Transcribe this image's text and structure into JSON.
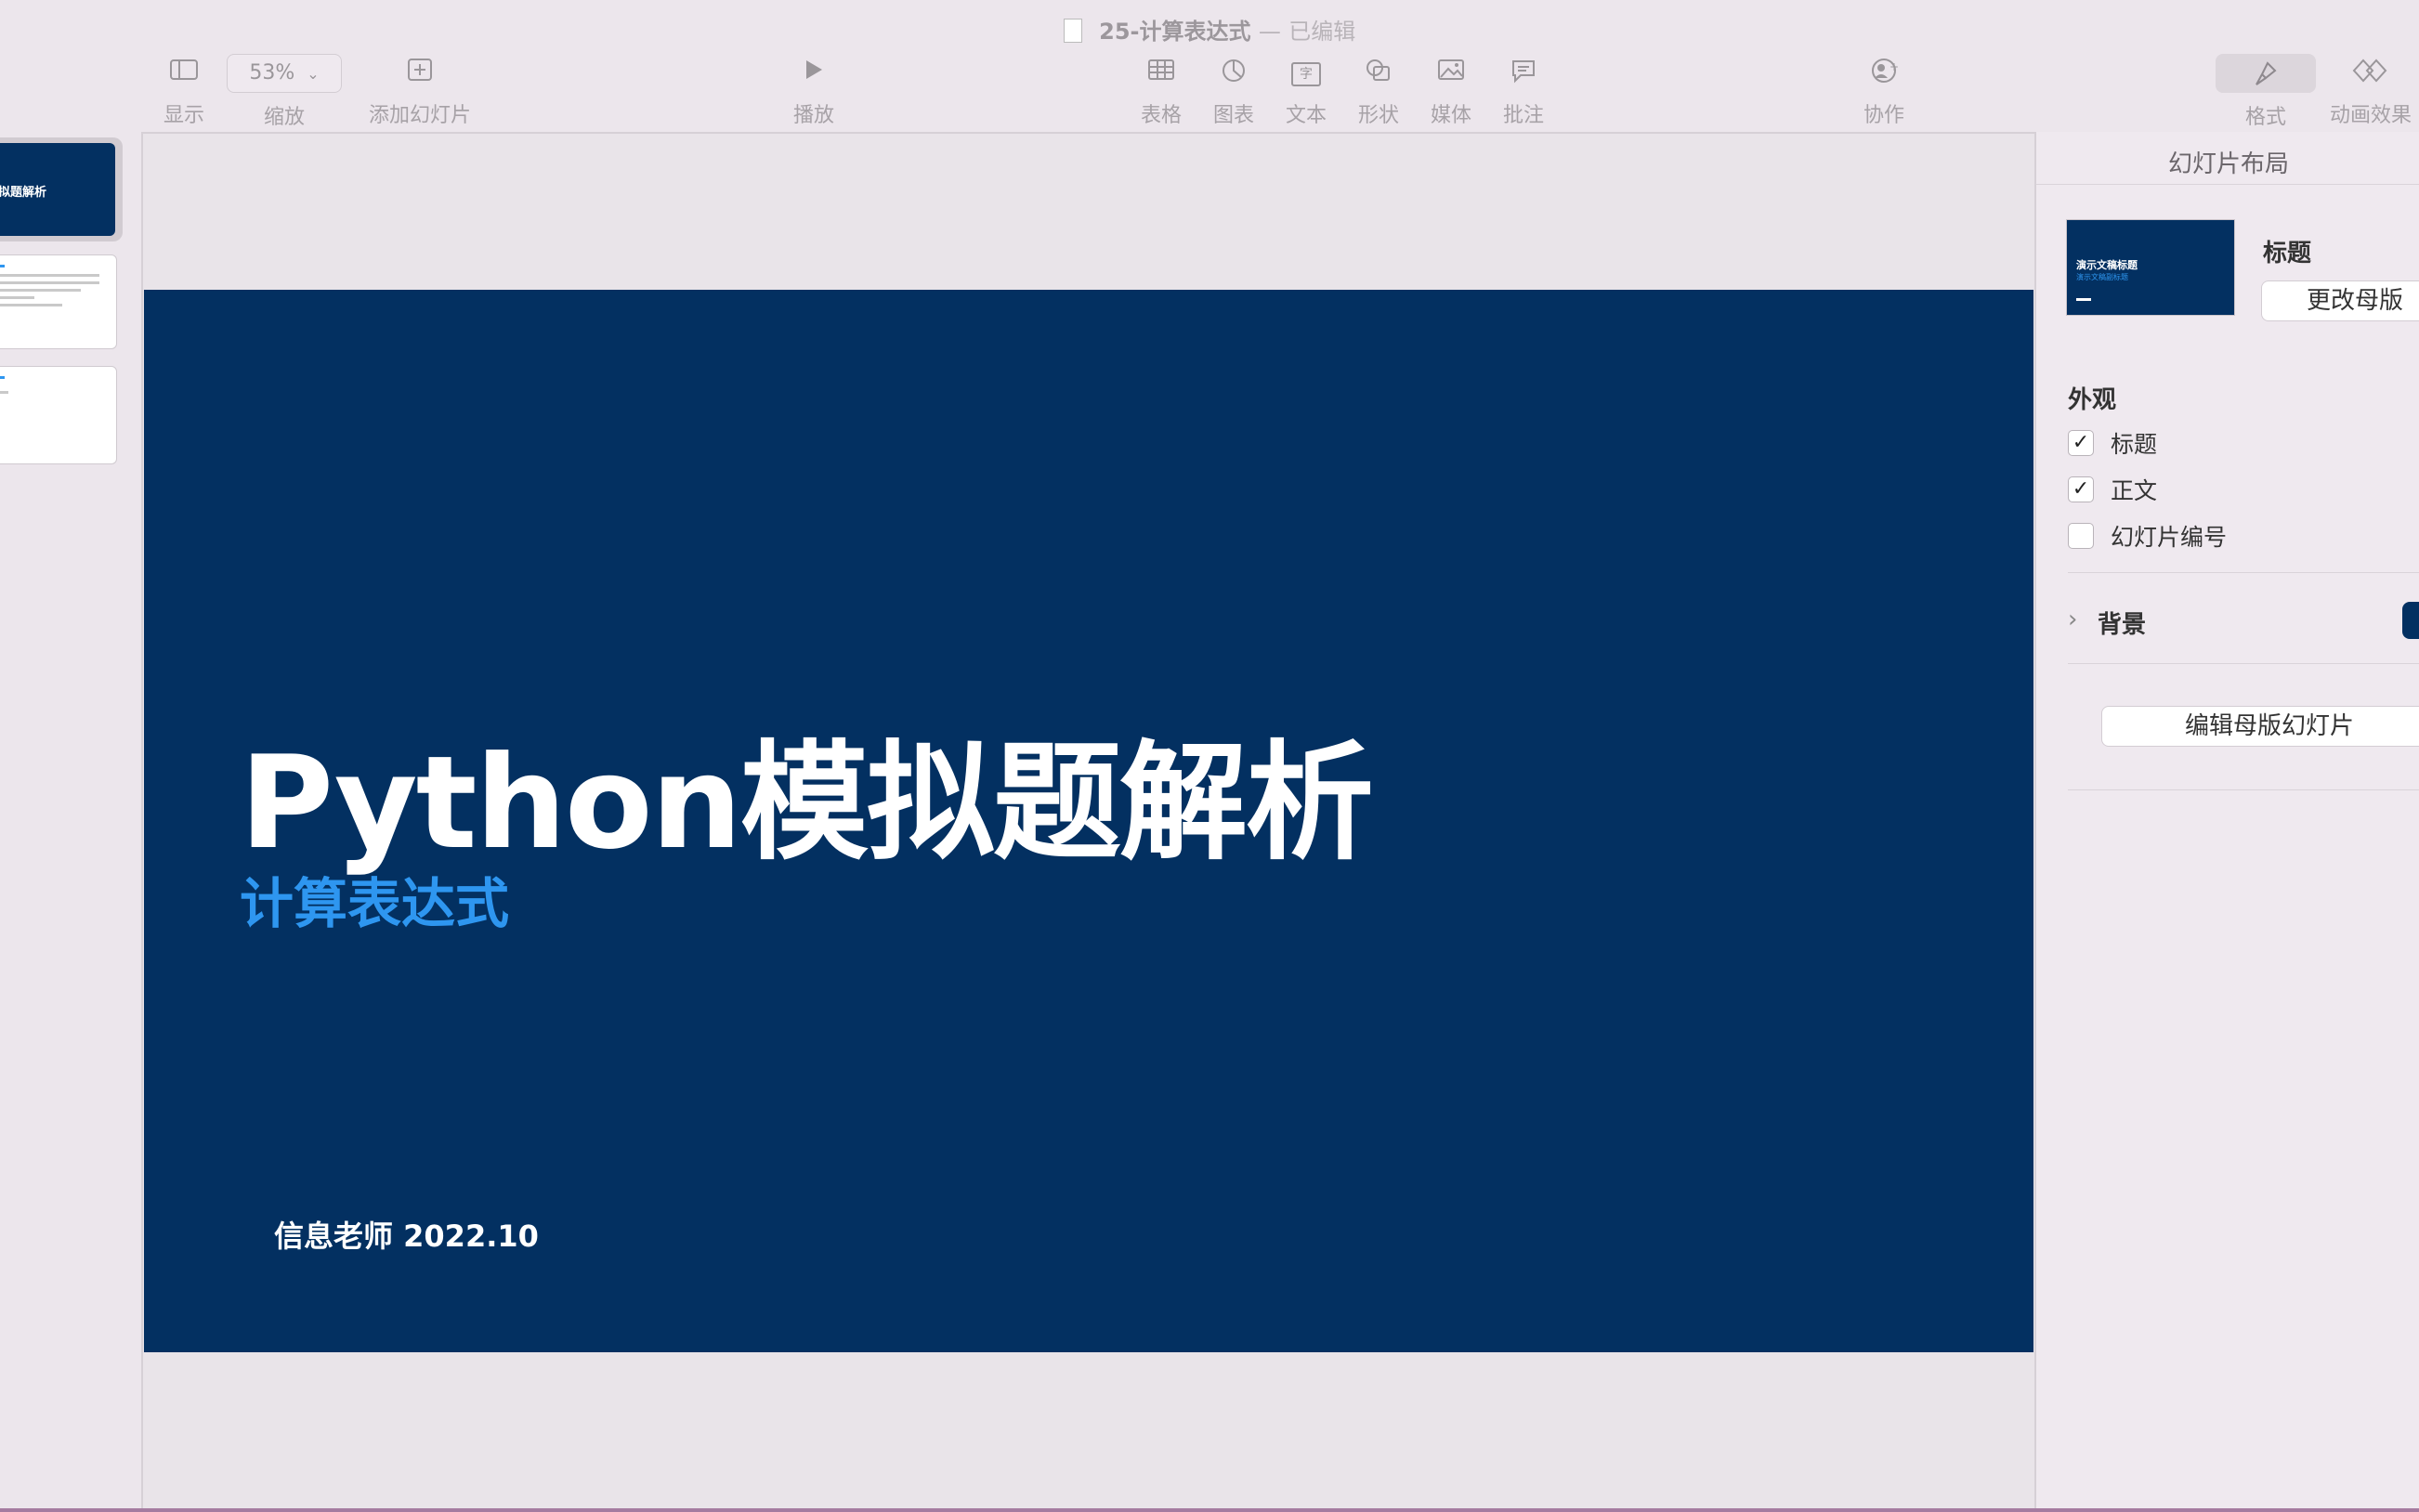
{
  "window": {
    "title": "25-计算表达式",
    "separator": "—",
    "status": "已编辑"
  },
  "toolbar": {
    "view": {
      "label": "显示",
      "icon": "sidebar-icon"
    },
    "zoom": {
      "label": "缩放",
      "value": "53%",
      "icon": "chevron-down-icon"
    },
    "add_slide": {
      "label": "添加幻灯片",
      "icon": "plus-square-icon"
    },
    "play": {
      "label": "播放",
      "icon": "play-icon"
    },
    "table": {
      "label": "表格",
      "icon": "table-icon"
    },
    "chart": {
      "label": "图表",
      "icon": "pie-chart-icon"
    },
    "text": {
      "label": "文本",
      "icon": "textbox-icon",
      "glyph": "字"
    },
    "shape": {
      "label": "形状",
      "icon": "shape-icon"
    },
    "media": {
      "label": "媒体",
      "icon": "photo-icon"
    },
    "comment": {
      "label": "批注",
      "icon": "comment-icon"
    },
    "collaborate": {
      "label": "协作",
      "icon": "collaborate-icon"
    },
    "format": {
      "label": "格式",
      "icon": "paintbrush-icon"
    },
    "animate": {
      "label": "动画效果",
      "icon": "diamond-icon"
    }
  },
  "sidebar": {
    "thumbnails": [
      {
        "text": "拟题解析",
        "selected": true
      },
      {
        "text": "",
        "selected": false
      },
      {
        "text": "",
        "selected": false
      }
    ]
  },
  "slide": {
    "title": "Python模拟题解析",
    "subtitle": "计算表达式",
    "author_date": "信息老师  2022.10",
    "background": "#033061",
    "subtitle_color": "#2e96f0"
  },
  "inspector": {
    "header": "幻灯片布局",
    "layout_thumb_title": "演示文稿标题",
    "layout_thumb_subtitle": "演示文稿副标题",
    "layout_name": "标题",
    "change_master_button": "更改母版",
    "appearance_label": "外观",
    "checkboxes": [
      {
        "label": "标题",
        "checked": true
      },
      {
        "label": "正文",
        "checked": true
      },
      {
        "label": "幻灯片编号",
        "checked": false
      }
    ],
    "background_label": "背景",
    "background_color": "#033061",
    "edit_master_button": "编辑母版幻灯片"
  }
}
